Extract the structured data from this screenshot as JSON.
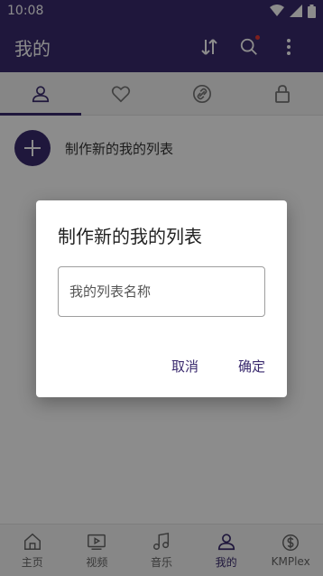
{
  "status_bar": {
    "time": "10:08",
    "icons": [
      "wifi-icon",
      "signal-icon",
      "battery-icon"
    ]
  },
  "app_bar": {
    "title": "我的",
    "actions": [
      "sort-icon",
      "search-icon",
      "more-vert-icon"
    ]
  },
  "tabs": [
    {
      "icon": "person-icon",
      "active": true
    },
    {
      "icon": "heart-icon",
      "active": false
    },
    {
      "icon": "link-icon",
      "active": false
    },
    {
      "icon": "lock-icon",
      "active": false
    }
  ],
  "main": {
    "create_label": "制作新的我的列表"
  },
  "dialog": {
    "title": "制作新的我的列表",
    "input_placeholder": "我的列表名称",
    "input_value": "",
    "cancel_label": "取消",
    "ok_label": "确定"
  },
  "bottom_nav": [
    {
      "label": "主页",
      "icon": "home-icon",
      "active": false
    },
    {
      "label": "视频",
      "icon": "video-icon",
      "active": false
    },
    {
      "label": "音乐",
      "icon": "music-icon",
      "active": false
    },
    {
      "label": "我的",
      "icon": "person-icon",
      "active": true
    },
    {
      "label": "KMPlex",
      "icon": "dollar-icon",
      "active": false
    }
  ],
  "colors": {
    "primary": "#3a2a6e",
    "scrim": "rgba(0,0,0,0.45)"
  }
}
